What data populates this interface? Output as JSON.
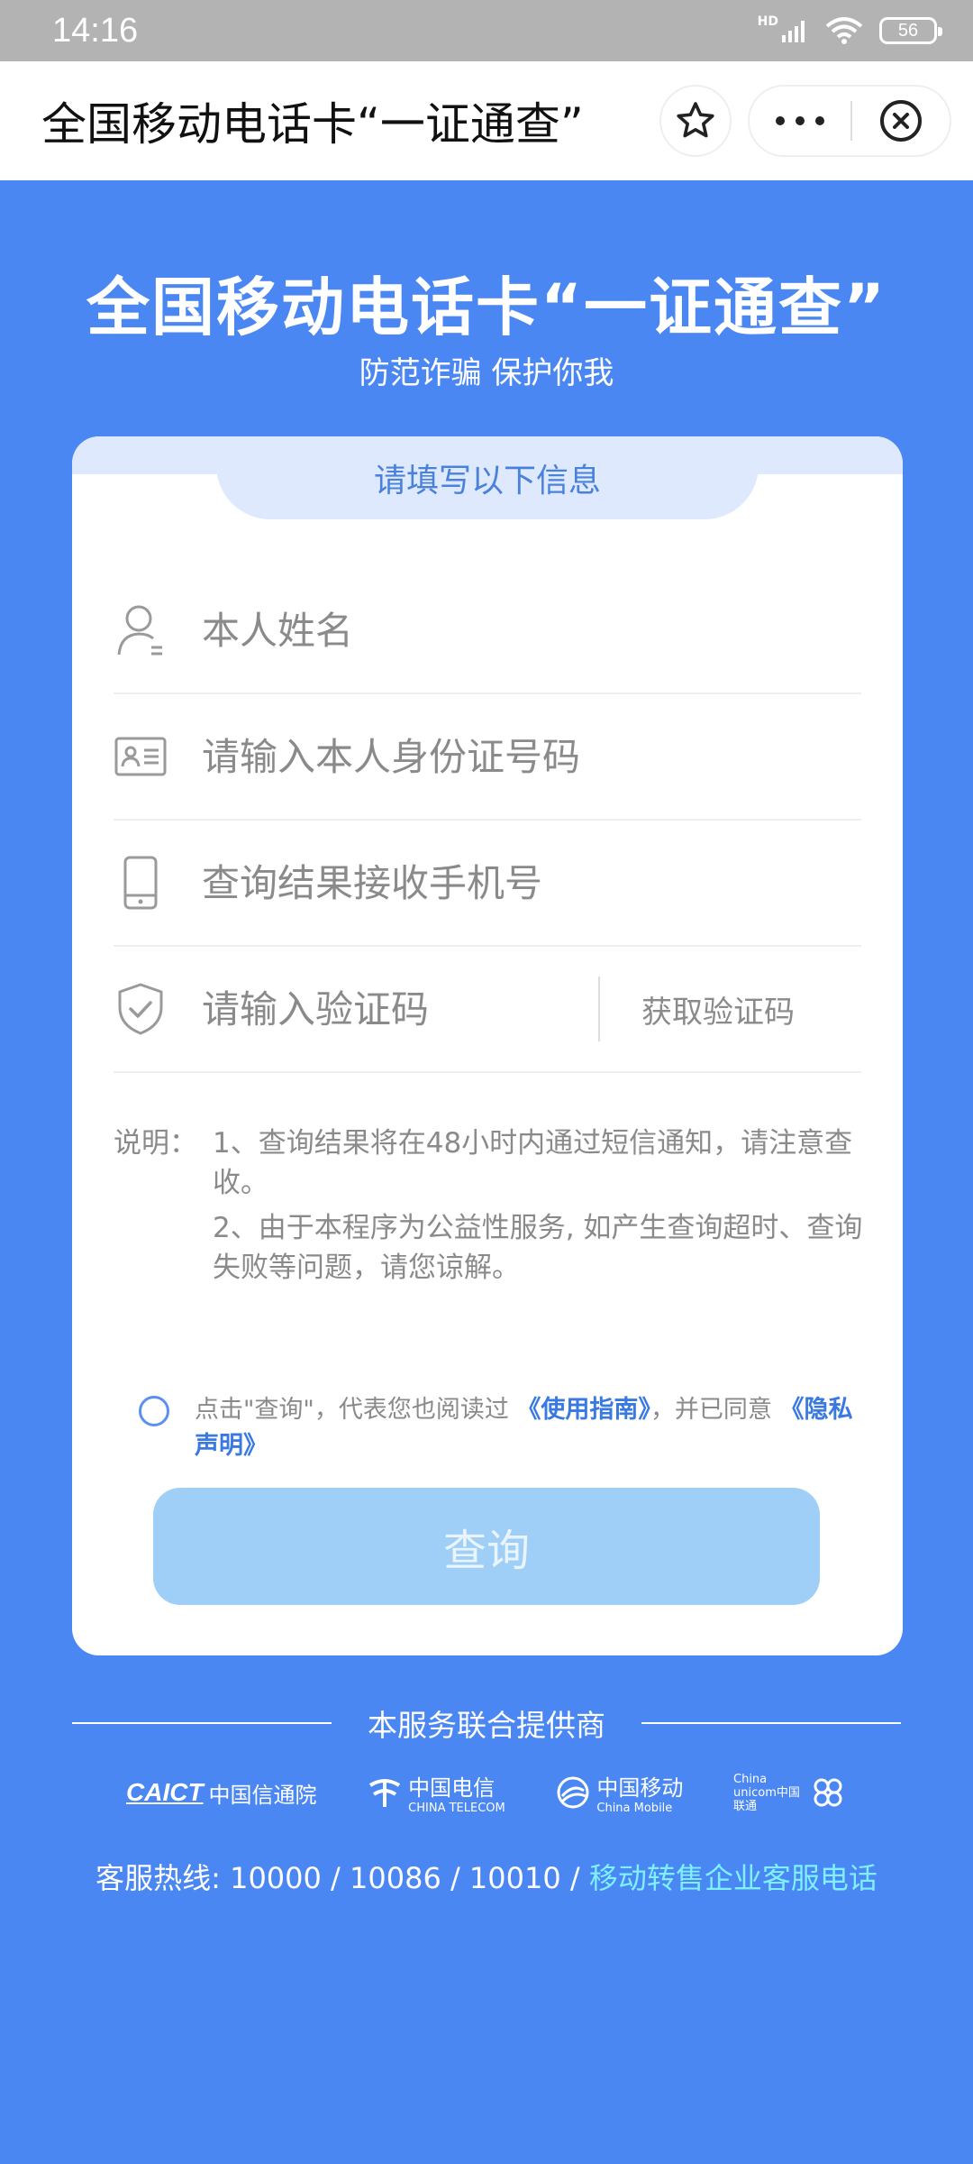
{
  "status_bar": {
    "time": "14:16",
    "network": "HD",
    "battery": "56",
    "icons": [
      "signal-icon",
      "wifi-icon",
      "battery-icon"
    ]
  },
  "title_bar": {
    "title": "全国移动电话卡“一证通查”",
    "icons": [
      "star-icon",
      "more-icon",
      "close-icon"
    ]
  },
  "hero": {
    "title": "全国移动电话卡“一证通查”",
    "subtitle": "防范诈骗 保护你我"
  },
  "form": {
    "heading": "请填写以下信息",
    "name_placeholder": "本人姓名",
    "id_placeholder": "请输入本人身份证号码",
    "phone_placeholder": "查询结果接收手机号",
    "code_placeholder": "请输入验证码",
    "get_code": "获取验证码",
    "icons": [
      "person-icon",
      "id-card-icon",
      "phone-icon",
      "shield-check-icon"
    ]
  },
  "notes": {
    "label": "说明：",
    "item1": "1、查询结果将在48小时内通过短信通知，请注意查收。",
    "item2": "2、由于本程序为公益性服务, 如产生查询超时、查询失败等问题，请您谅解。"
  },
  "agreement": {
    "prefix": "点击\"查询\"，代表您也阅读过",
    "guide_link": "《使用指南》",
    "middle": "，并已同意",
    "privacy_link": "《隐私声明》"
  },
  "query_button": "查询",
  "footer": {
    "providers_title": "本服务联合提供商",
    "logos": {
      "caict_en": "CAICT",
      "caict_cn": "中国信通院",
      "telecom_cn": "中国电信",
      "telecom_en": "CHINA TELECOM",
      "mobile_cn": "中国移动",
      "mobile_en": "China Mobile",
      "unicom_en": "China unicom中国联通"
    },
    "hotline_prefix": "客服热线: 10000 / 10086 / 10010 /",
    "hotline_link": "移动转售企业客服电话"
  },
  "colors": {
    "background": "#4a87f3",
    "accent": "#4a82db",
    "button": "#9fcff6",
    "link": "#7ef0ff"
  }
}
